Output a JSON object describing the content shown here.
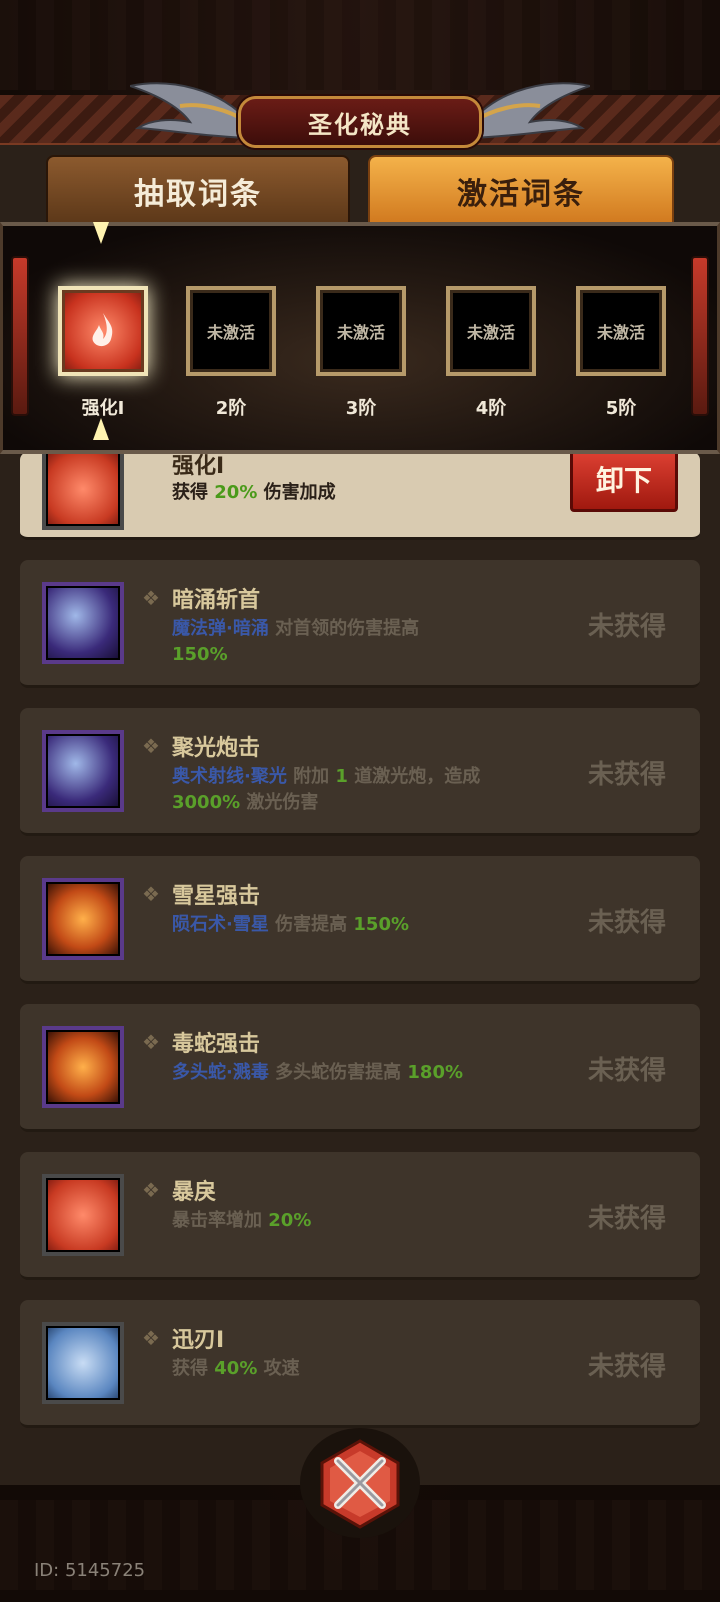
{
  "header": {
    "title": "圣化秘典"
  },
  "tabs": [
    {
      "label": "抽取词条",
      "active": false
    },
    {
      "label": "激活词条",
      "active": true
    }
  ],
  "tiers": [
    {
      "label": "强化I",
      "slot_text": "",
      "active": true
    },
    {
      "label": "2阶",
      "slot_text": "未激活",
      "active": false
    },
    {
      "label": "3阶",
      "slot_text": "未激活",
      "active": false
    },
    {
      "label": "4阶",
      "slot_text": "未激活",
      "active": false
    },
    {
      "label": "5阶",
      "slot_text": "未激活",
      "active": false
    }
  ],
  "equipped": {
    "name": "强化I",
    "desc_prefix": "获得",
    "desc_value": "20%",
    "desc_suffix": "伤害加成",
    "button": "卸下"
  },
  "skills": [
    {
      "name": "暗涌斩首",
      "skill_tag": "魔法弹·暗涌",
      "desc_a": "对首领的伤害提高",
      "value": "150%",
      "desc_b": "",
      "status": "未获得",
      "icon": "comet-icon"
    },
    {
      "name": "聚光炮击",
      "skill_tag": "奥术射线·聚光",
      "desc_a": "附加",
      "value_a": "1",
      "desc_mid": "道激光炮，造成",
      "value": "3000%",
      "desc_b": "激光伤害",
      "status": "未获得",
      "icon": "beam-icon"
    },
    {
      "name": "雪星强击",
      "skill_tag": "陨石术·雪星",
      "desc_a": "伤害提高",
      "value": "150%",
      "desc_b": "",
      "status": "未获得",
      "icon": "meteor-icon"
    },
    {
      "name": "毒蛇强击",
      "skill_tag": "多头蛇·溅毒",
      "desc_a": "多头蛇伤害提高",
      "value": "180%",
      "desc_b": "",
      "status": "未获得",
      "icon": "serpent-icon"
    },
    {
      "name": "暴戾",
      "skill_tag": "",
      "desc_a": "暴击率增加",
      "value": "20%",
      "desc_b": "",
      "status": "未获得",
      "icon": "fury-icon"
    },
    {
      "name": "迅刃I",
      "skill_tag": "",
      "desc_a": "获得",
      "value": "40%",
      "desc_b": "攻速",
      "status": "未获得",
      "icon": "blade-icon"
    }
  ],
  "footer": {
    "uid": "ID: 5145725"
  }
}
